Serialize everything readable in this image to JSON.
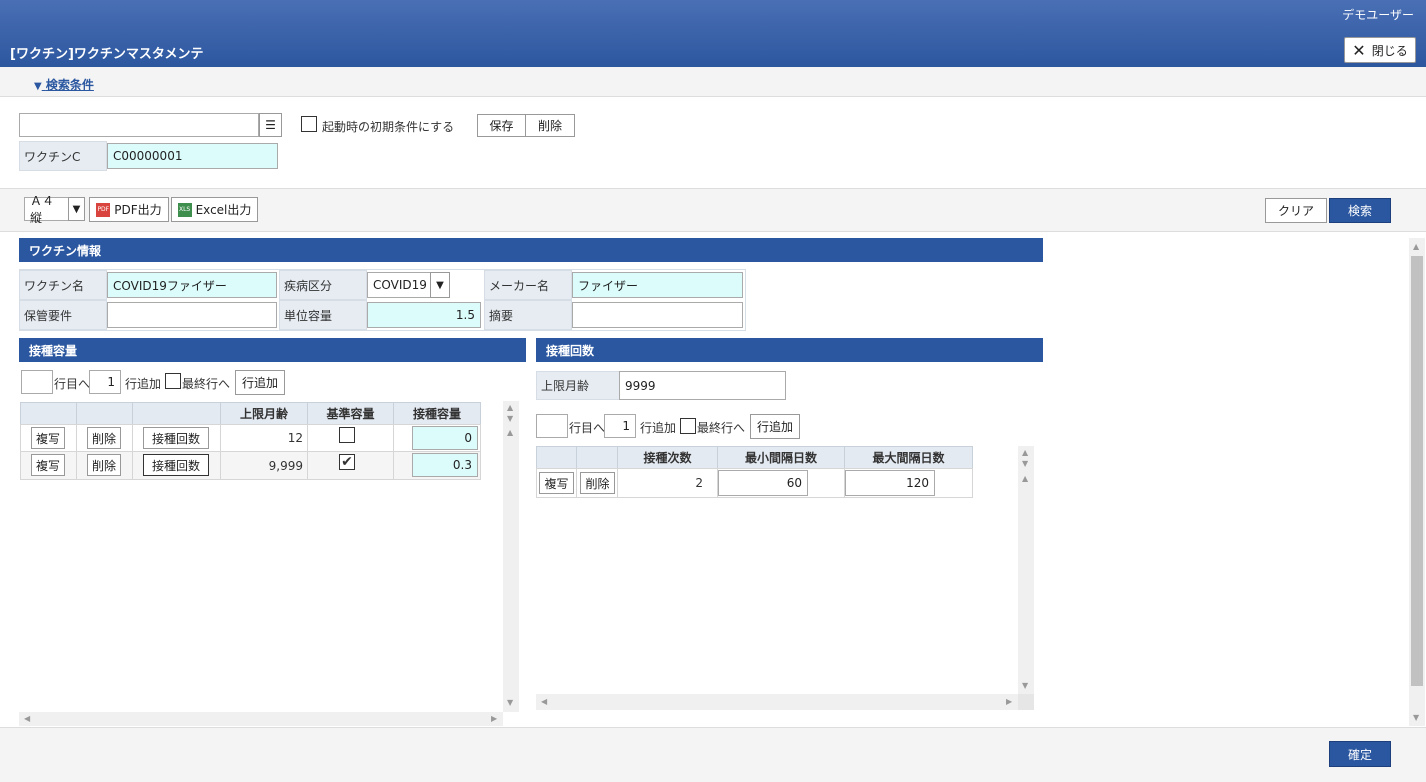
{
  "header": {
    "user": "デモユーザー",
    "title": "[ワクチン]ワクチンマスタメンテ",
    "close_label": "閉じる"
  },
  "search": {
    "toggle_label": "検索条件",
    "preset_value": "",
    "startup_label": "起動時の初期条件にする",
    "save_label": "保存",
    "delete_label": "削除",
    "vaccine_code_label": "ワクチンC",
    "vaccine_code_value": "C00000001"
  },
  "toolbar": {
    "paper_value": "Ａ４縦",
    "pdf_label": "PDF出力",
    "excel_label": "Excel出力",
    "clear_label": "クリア",
    "search_label": "検索"
  },
  "vaccine_info": {
    "heading": "ワクチン情報",
    "name_label": "ワクチン名",
    "name_value": "COVID19ファイザー",
    "disease_label": "疾病区分",
    "disease_value": "COVID19",
    "maker_label": "メーカー名",
    "maker_value": "ファイザー",
    "storage_label": "保管要件",
    "storage_value": "",
    "unit_label": "単位容量",
    "unit_value": "1.5",
    "note_label": "摘要",
    "note_value": ""
  },
  "dose": {
    "heading": "接種容量",
    "row_to_label": "行目へ",
    "row_count": "1",
    "add_label": "行追加",
    "last_row_label": "最終行へ",
    "add_button": "行追加",
    "columns": [
      "上限月齢",
      "基準容量",
      "接種容量"
    ],
    "copy_label": "複写",
    "del_label": "削除",
    "count_label": "接種回数",
    "rows": [
      {
        "age": "12",
        "standard": false,
        "amount": "0"
      },
      {
        "age": "9,999",
        "standard": true,
        "amount": "0.3"
      }
    ]
  },
  "times": {
    "heading": "接種回数",
    "age_limit_label": "上限月齢",
    "age_limit_value": "9999",
    "row_to_label": "行目へ",
    "row_count": "1",
    "add_label": "行追加",
    "last_row_label": "最終行へ",
    "add_button": "行追加",
    "columns": [
      "接種次数",
      "最小間隔日数",
      "最大間隔日数"
    ],
    "copy_label": "複写",
    "del_label": "削除",
    "rows": [
      {
        "no": "2",
        "min": "60",
        "max": "120"
      }
    ]
  },
  "footer": {
    "confirm_label": "確定"
  }
}
